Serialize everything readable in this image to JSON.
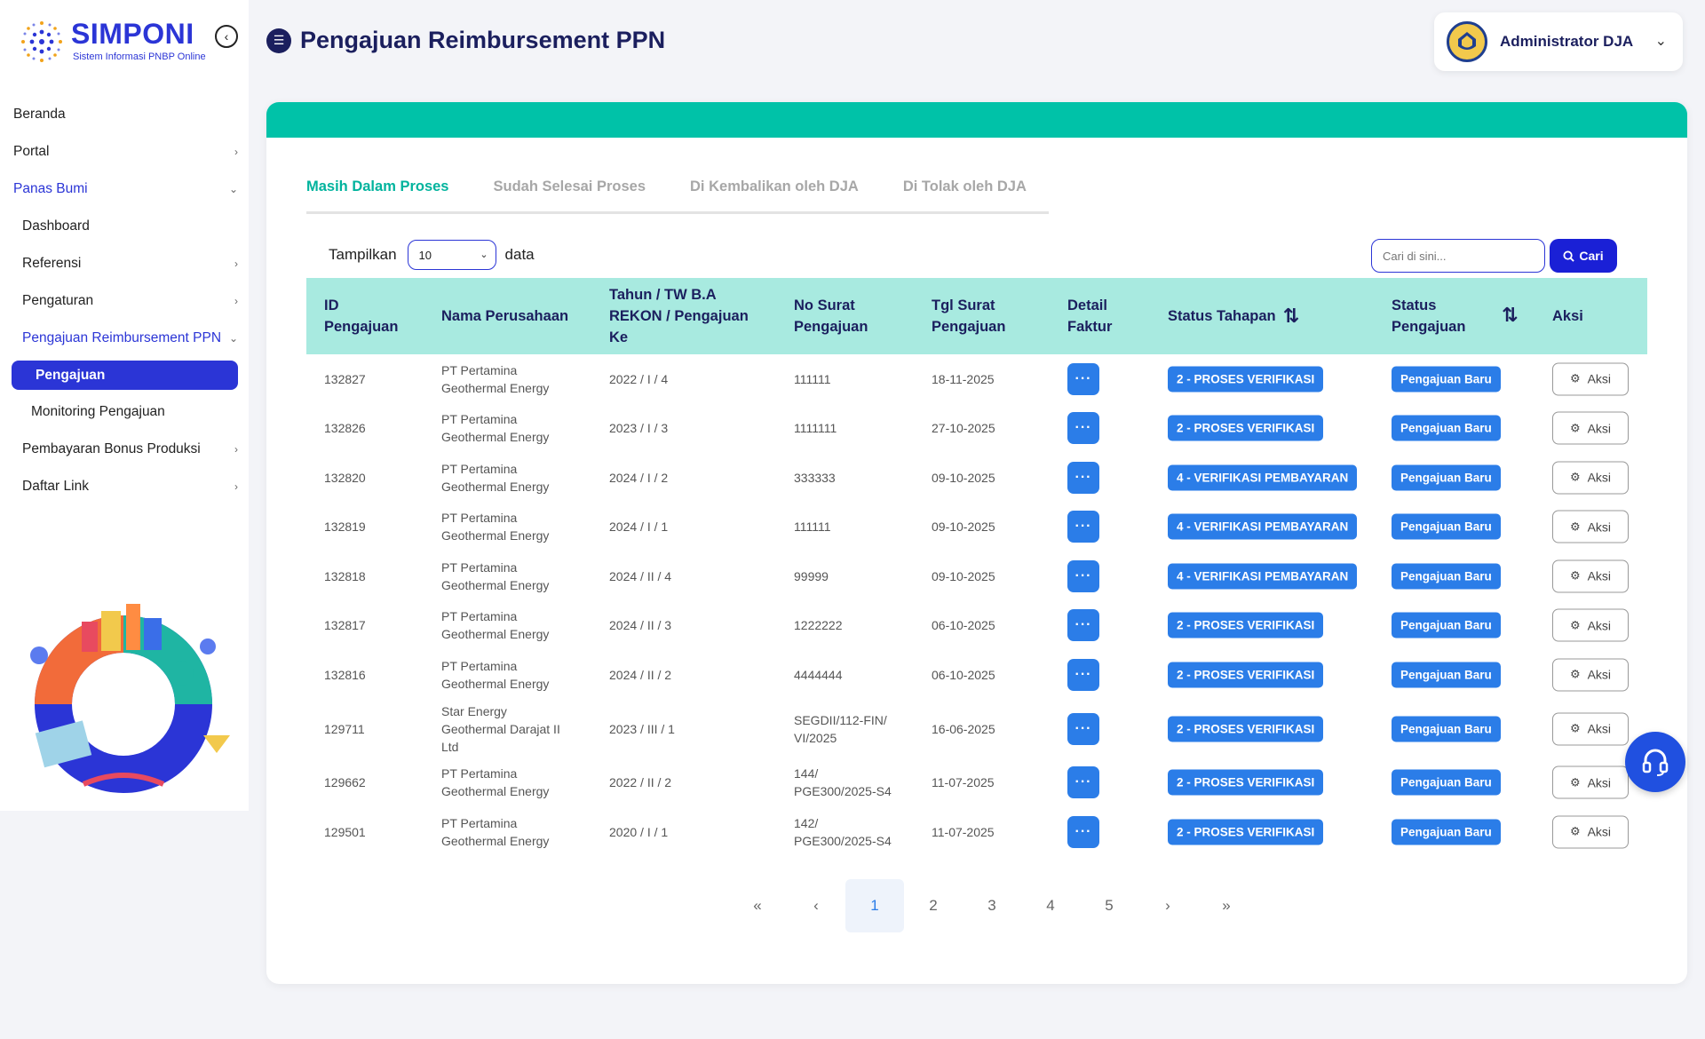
{
  "brand": {
    "title": "SIMPONI",
    "subtitle": "Sistem Informasi PNBP Online"
  },
  "page": {
    "title": "Pengajuan Reimbursement PPN"
  },
  "user": {
    "name": "Administrator DJA"
  },
  "sidebar": {
    "items": [
      {
        "label": "Beranda"
      },
      {
        "label": "Portal"
      },
      {
        "label": "Panas Bumi"
      },
      {
        "label": "Dashboard"
      },
      {
        "label": "Referensi"
      },
      {
        "label": "Pengaturan"
      },
      {
        "label": "Pengajuan Reimbursement PPN"
      },
      {
        "label": "Pengajuan"
      },
      {
        "label": "Monitoring Pengajuan"
      },
      {
        "label": "Pembayaran Bonus Produksi"
      },
      {
        "label": "Daftar Link"
      }
    ]
  },
  "tabs": [
    {
      "label": "Masih Dalam Proses"
    },
    {
      "label": "Sudah Selesai Proses"
    },
    {
      "label": "Di Kembalikan oleh DJA"
    },
    {
      "label": "Di Tolak oleh DJA"
    }
  ],
  "controls": {
    "show_label": "Tampilkan",
    "page_size": "10",
    "data_label": "data",
    "search_placeholder": "Cari di sini...",
    "search_button": "Cari"
  },
  "table": {
    "headers": {
      "id": [
        "ID",
        "Pengajuan"
      ],
      "company": "Nama Perusahaan",
      "period": [
        "Tahun / TW B.A",
        "REKON / Pengajuan",
        "Ke"
      ],
      "letter_no": [
        "No Surat",
        "Pengajuan"
      ],
      "letter_date": [
        "Tgl Surat",
        "Pengajuan"
      ],
      "detail": [
        "Detail",
        "Faktur"
      ],
      "stage": "Status Tahapan",
      "status": [
        "Status",
        "Pengajuan"
      ],
      "action": "Aksi"
    },
    "detail_glyph": "···",
    "action_label": "Aksi",
    "rows": [
      {
        "id": "132827",
        "company": [
          "PT Pertamina",
          "Geothermal Energy"
        ],
        "period": "2022 / I / 4",
        "letter_no": [
          "111111"
        ],
        "date": "18-11-2025",
        "stage": "2 - PROSES VERIFIKASI",
        "status": "Pengajuan Baru"
      },
      {
        "id": "132826",
        "company": [
          "PT Pertamina",
          "Geothermal Energy"
        ],
        "period": "2023 / I / 3",
        "letter_no": [
          "1111111"
        ],
        "date": "27-10-2025",
        "stage": "2 - PROSES VERIFIKASI",
        "status": "Pengajuan Baru"
      },
      {
        "id": "132820",
        "company": [
          "PT Pertamina",
          "Geothermal Energy"
        ],
        "period": "2024 / I / 2",
        "letter_no": [
          "333333"
        ],
        "date": "09-10-2025",
        "stage": "4 - VERIFIKASI PEMBAYARAN",
        "status": "Pengajuan Baru"
      },
      {
        "id": "132819",
        "company": [
          "PT Pertamina",
          "Geothermal Energy"
        ],
        "period": "2024 / I / 1",
        "letter_no": [
          "111111"
        ],
        "date": "09-10-2025",
        "stage": "4 - VERIFIKASI PEMBAYARAN",
        "status": "Pengajuan Baru"
      },
      {
        "id": "132818",
        "company": [
          "PT Pertamina",
          "Geothermal Energy"
        ],
        "period": "2024 / II / 4",
        "letter_no": [
          "99999"
        ],
        "date": "09-10-2025",
        "stage": "4 - VERIFIKASI PEMBAYARAN",
        "status": "Pengajuan Baru"
      },
      {
        "id": "132817",
        "company": [
          "PT Pertamina",
          "Geothermal Energy"
        ],
        "period": "2024 / II / 3",
        "letter_no": [
          "1222222"
        ],
        "date": "06-10-2025",
        "stage": "2 - PROSES VERIFIKASI",
        "status": "Pengajuan Baru"
      },
      {
        "id": "132816",
        "company": [
          "PT Pertamina",
          "Geothermal Energy"
        ],
        "period": "2024 / II / 2",
        "letter_no": [
          "4444444"
        ],
        "date": "06-10-2025",
        "stage": "2 - PROSES VERIFIKASI",
        "status": "Pengajuan Baru"
      },
      {
        "id": "129711",
        "company": [
          "Star Energy",
          "Geothermal Darajat II",
          "Ltd"
        ],
        "period": "2023 / III / 1",
        "letter_no": [
          "SEGDII/112-FIN/",
          "VI/2025"
        ],
        "date": "16-06-2025",
        "stage": "2 - PROSES VERIFIKASI",
        "status": "Pengajuan Baru"
      },
      {
        "id": "129662",
        "company": [
          "PT Pertamina",
          "Geothermal Energy"
        ],
        "period": "2022 / II / 2",
        "letter_no": [
          "144/",
          "PGE300/2025-S4"
        ],
        "date": "11-07-2025",
        "stage": "2 - PROSES VERIFIKASI",
        "status": "Pengajuan Baru"
      },
      {
        "id": "129501",
        "company": [
          "PT Pertamina",
          "Geothermal Energy"
        ],
        "period": "2020 / I / 1",
        "letter_no": [
          "142/",
          "PGE300/2025-S4"
        ],
        "date": "11-07-2025",
        "stage": "2 - PROSES VERIFIKASI",
        "status": "Pengajuan Baru"
      }
    ]
  },
  "pagination": {
    "first": "«",
    "prev": "‹",
    "pages": [
      "1",
      "2",
      "3",
      "4",
      "5"
    ],
    "current": "1",
    "next": "›",
    "last": "»"
  },
  "colors": {
    "accent": "#2b35d6",
    "teal": "#00c2a8",
    "badge": "#2b7de8",
    "header_bg": "#a8eae0"
  }
}
